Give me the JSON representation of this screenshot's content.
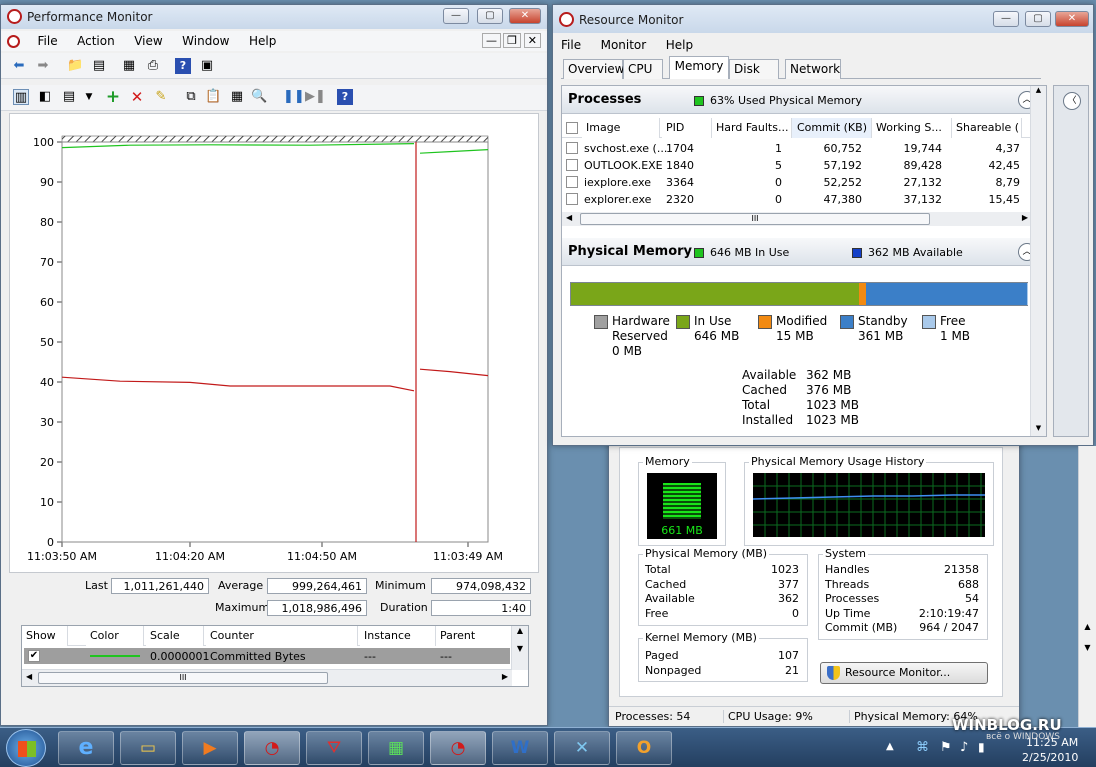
{
  "perfmon": {
    "title": "Performance Monitor",
    "menu": [
      "File",
      "Action",
      "View",
      "Window",
      "Help"
    ],
    "graph_y_ticks": [
      "100",
      "90",
      "80",
      "70",
      "60",
      "50",
      "40",
      "30",
      "20",
      "10",
      "0"
    ],
    "graph_x_ticks": [
      "11:03:50 AM",
      "11:04:20 AM",
      "11:04:50 AM",
      "11:03:49 AM"
    ],
    "stats": {
      "last_label": "Last",
      "last": "1,011,261,440",
      "average_label": "Average",
      "average": "999,264,461",
      "minimum_label": "Minimum",
      "minimum": "974,098,432",
      "maximum_label": "Maximum",
      "maximum": "1,018,986,496",
      "duration_label": "Duration",
      "duration": "1:40"
    },
    "counter_headers": [
      "Show",
      "Color",
      "Scale",
      "Counter",
      "Instance",
      "Parent"
    ],
    "counter_row": {
      "scale": "0.0000001",
      "counter": "Committed Bytes",
      "instance": "---",
      "parent": "---"
    },
    "hscroll_grip": "III"
  },
  "resmon": {
    "title": "Resource Monitor",
    "menu": [
      "File",
      "Monitor",
      "Help"
    ],
    "tabs": [
      "Overview",
      "CPU",
      "Memory",
      "Disk",
      "Network"
    ],
    "processes": {
      "title": "Processes",
      "summary": "63% Used Physical Memory",
      "headers": [
        "Image",
        "PID",
        "Hard Faults...",
        "Commit (KB)",
        "Working S...",
        "Shareable ("
      ],
      "rows": [
        [
          "svchost.exe (...",
          "1704",
          "1",
          "60,752",
          "19,744",
          "4,37"
        ],
        [
          "OUTLOOK.EXE",
          "1840",
          "5",
          "57,192",
          "89,428",
          "42,45"
        ],
        [
          "iexplore.exe",
          "3364",
          "0",
          "52,252",
          "27,132",
          "8,79"
        ],
        [
          "explorer.exe",
          "2320",
          "0",
          "47,380",
          "37,132",
          "15,45"
        ]
      ],
      "hscroll_grip": "III"
    },
    "physical_memory": {
      "title": "Physical Memory",
      "in_use_summary": "646 MB In Use",
      "available_summary": "362 MB Available",
      "bar": {
        "hardware_reserved_mb": 0,
        "in_use_mb": 646,
        "modified_mb": 15,
        "standby_mb": 361,
        "free_mb": 1,
        "total_mb": 1023
      },
      "legend": [
        {
          "label1": "Hardware",
          "label2": "Reserved",
          "value": "0 MB",
          "color": "#a0a0a0"
        },
        {
          "label1": "In Use",
          "label2": "",
          "value": "646 MB",
          "color": "#7aa619"
        },
        {
          "label1": "Modified",
          "label2": "",
          "value": "15 MB",
          "color": "#f28a12"
        },
        {
          "label1": "Standby",
          "label2": "",
          "value": "361 MB",
          "color": "#3b7fc8"
        },
        {
          "label1": "Free",
          "label2": "",
          "value": "1 MB",
          "color": "#a9c9ea"
        }
      ],
      "details": [
        {
          "k": "Available",
          "v": "362 MB"
        },
        {
          "k": "Cached",
          "v": "376 MB"
        },
        {
          "k": "Total",
          "v": "1023 MB"
        },
        {
          "k": "Installed",
          "v": "1023 MB"
        }
      ]
    }
  },
  "taskmgr": {
    "memory_label": "Memory",
    "memory_value": "661 MB",
    "history_label": "Physical Memory Usage History",
    "physical": {
      "title": "Physical Memory (MB)",
      "rows": [
        {
          "k": "Total",
          "v": "1023"
        },
        {
          "k": "Cached",
          "v": "377"
        },
        {
          "k": "Available",
          "v": "362"
        },
        {
          "k": "Free",
          "v": "0"
        }
      ]
    },
    "kernel": {
      "title": "Kernel Memory (MB)",
      "rows": [
        {
          "k": "Paged",
          "v": "107"
        },
        {
          "k": "Nonpaged",
          "v": "21"
        }
      ]
    },
    "system": {
      "title": "System",
      "rows": [
        {
          "k": "Handles",
          "v": "21358"
        },
        {
          "k": "Threads",
          "v": "688"
        },
        {
          "k": "Processes",
          "v": "54"
        },
        {
          "k": "Up Time",
          "v": "2:10:19:47"
        },
        {
          "k": "Commit (MB)",
          "v": "964 / 2047"
        }
      ]
    },
    "resmon_button": "Resource Monitor...",
    "status": {
      "processes": "Processes: 54",
      "cpu": "CPU Usage: 9%",
      "phys": "Physical Memory: 64%"
    }
  },
  "taskbar": {
    "clock_time": "11:25 AM",
    "clock_date": "2/25/2010",
    "watermark1": "WINBLOG.RU",
    "watermark2": "всё о WINDOWS"
  }
}
